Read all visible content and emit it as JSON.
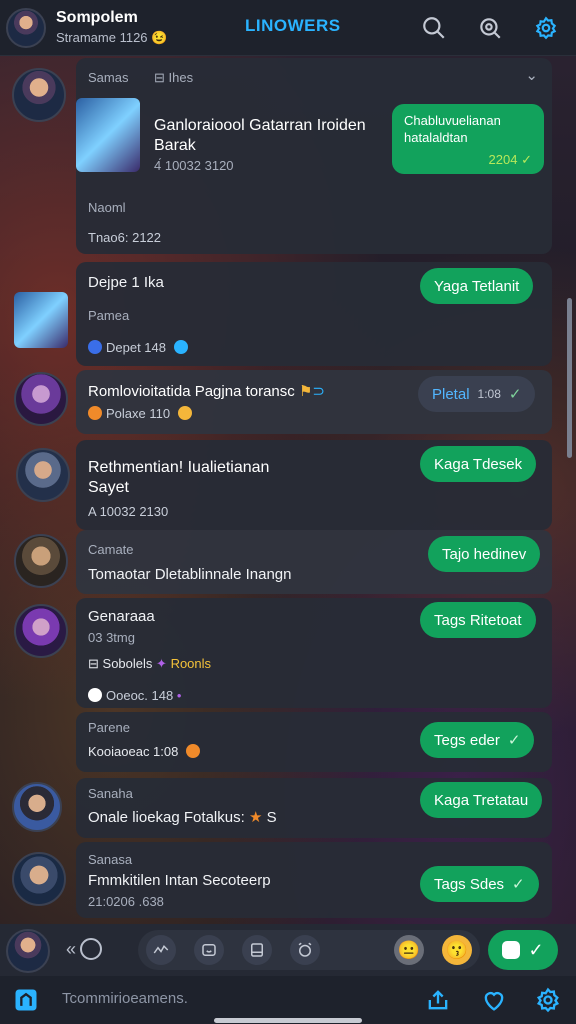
{
  "header": {
    "name": "Sompolem",
    "subtitle": "Stramame 1126",
    "subtitle_emoji": "😉",
    "title": "LINOWERS",
    "icons": [
      "search-icon",
      "camera-search-icon",
      "settings-gear-icon"
    ]
  },
  "messages": [
    {
      "top_label": "Samas",
      "tab_label": "Ihes",
      "title": "Ganloraioool Gatarran Iroiden Barak",
      "meta": "4́ 10032 3120",
      "bubble_text": "Chabluvuelianan hatalaldtan",
      "bubble_time": "2204",
      "sub_name": "Naoml",
      "sub_time": "Tnao6: 2122"
    },
    {
      "name": "Dejpe 1 Ika",
      "sub": "Pamea",
      "meta": "Depet 148",
      "action": "Yaga Tetlanit"
    },
    {
      "title": "Romlovioitatida Pagjna toransc",
      "meta": "Polaxe 110",
      "action": "Pletal",
      "action_time": "1:08"
    },
    {
      "title": "Rethmentian! Iualietianan Sayet",
      "meta": "A 10032 2130",
      "action": "Kaga Tdesek"
    },
    {
      "sub": "Camate",
      "title": "Tomaotar Dletablinnale Inangn",
      "action": "Tajo hedinev"
    },
    {
      "name": "Genaraaa",
      "sub": "03 3tmg",
      "line": "Sobolels",
      "line_tag": "Roonls",
      "meta": "Ooeoc. 148",
      "action": "Tags Ritetoat"
    },
    {
      "sub": "Parene",
      "meta": "Kooiaoeac 1:08",
      "action": "Tegs eder"
    },
    {
      "sub": "Sanaha",
      "title": "Onale lioekag Fotalkus:",
      "title_tail": "S",
      "action": "Kaga Tretatau"
    },
    {
      "sub": "Sanasa",
      "title": "Fmmkitilen Intan Secoteerp",
      "meta": "21:0206 .638",
      "action": "Tags Sdes"
    }
  ],
  "composer": {
    "left_glyph": "«",
    "tools": [
      "scribble-icon",
      "sticker-icon",
      "book-icon",
      "alarm-icon"
    ],
    "emojis": [
      "😐",
      "😗"
    ],
    "send_label": "✓"
  },
  "bottom_nav": {
    "label": "Tcommirioeamens.",
    "icons": [
      "home-icon",
      "upload-icon",
      "heart-icon",
      "gear-icon"
    ]
  },
  "colors": {
    "accent_green": "#12a25c",
    "title_blue": "#2ab3ff",
    "panel": "#282c36"
  }
}
